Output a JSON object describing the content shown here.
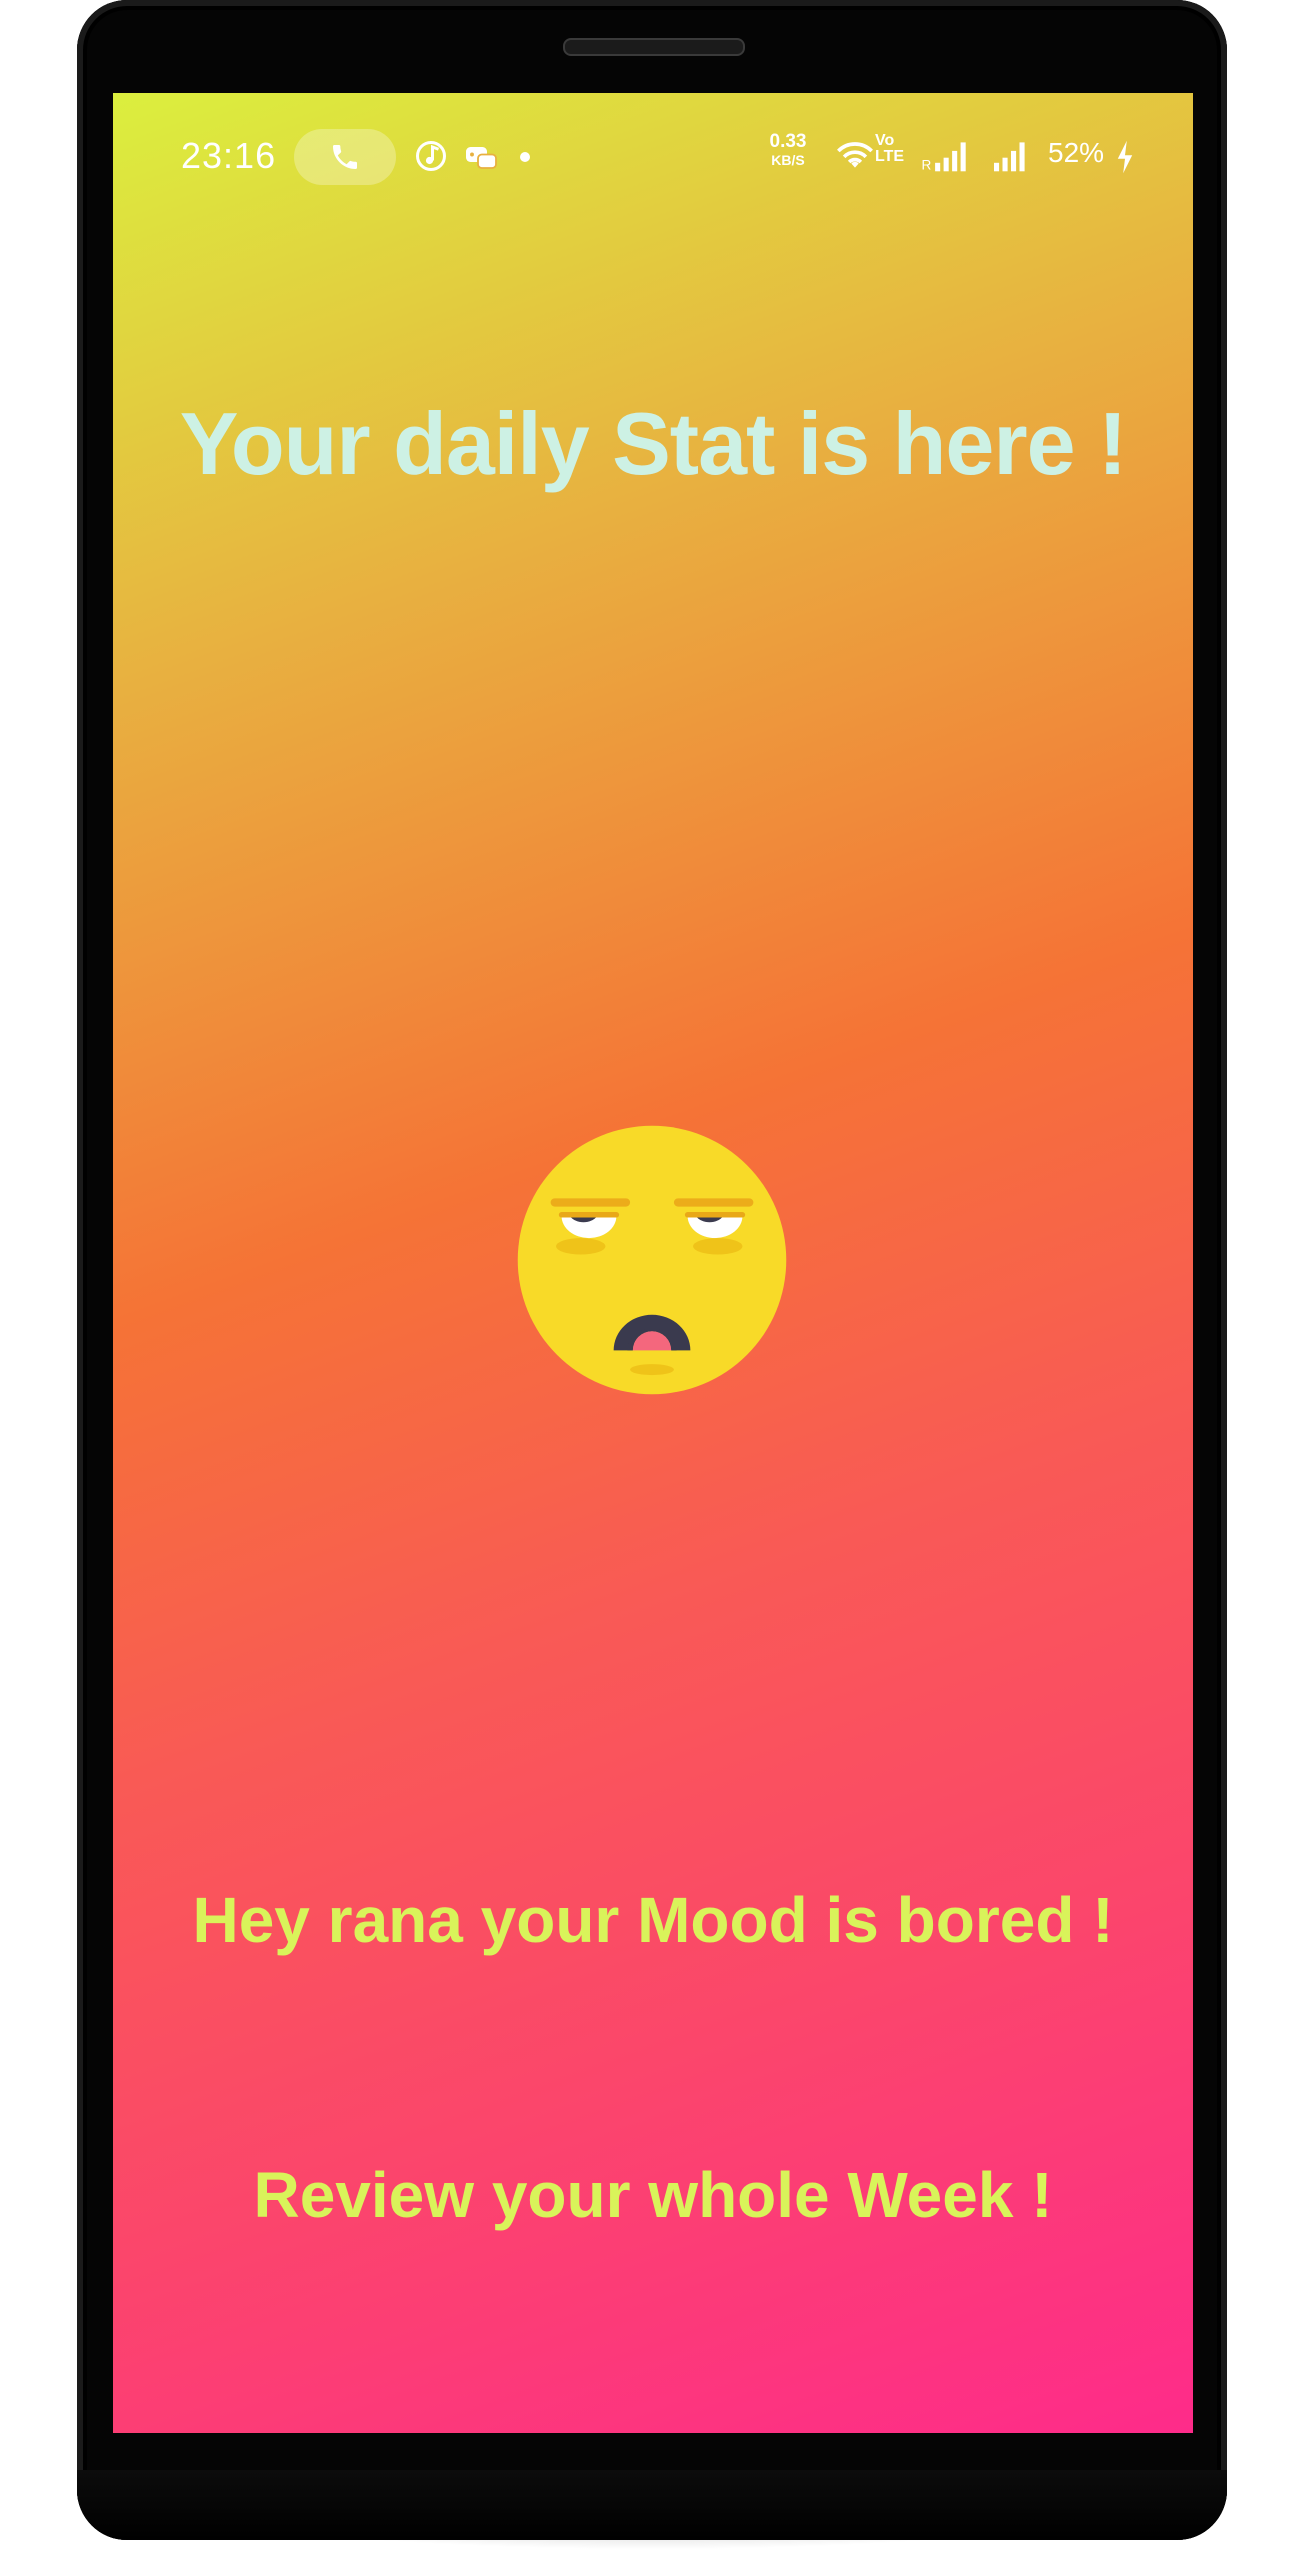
{
  "status_bar": {
    "time": "23:16",
    "net_speed_value": "0.33",
    "net_speed_unit": "KB/S",
    "volte": "Vo\nLTE",
    "battery": "52%",
    "icons": [
      "phone-call-icon",
      "music-icon",
      "game-icon",
      "dot-icon",
      "wifi-icon",
      "signal-icon",
      "charging-icon"
    ]
  },
  "main": {
    "title": "Your daily Stat is here !",
    "mood_message": "Hey rana your Mood is bored !",
    "review_link": "Review your whole Week !",
    "mood_emoji": "bored-face-icon"
  },
  "colors": {
    "gradient_top": "#dbef3e",
    "gradient_mid": "#f57336",
    "gradient_bottom": "#fe2b8a",
    "title": "#cdf1e4",
    "accent_text": "#d9f35a"
  }
}
